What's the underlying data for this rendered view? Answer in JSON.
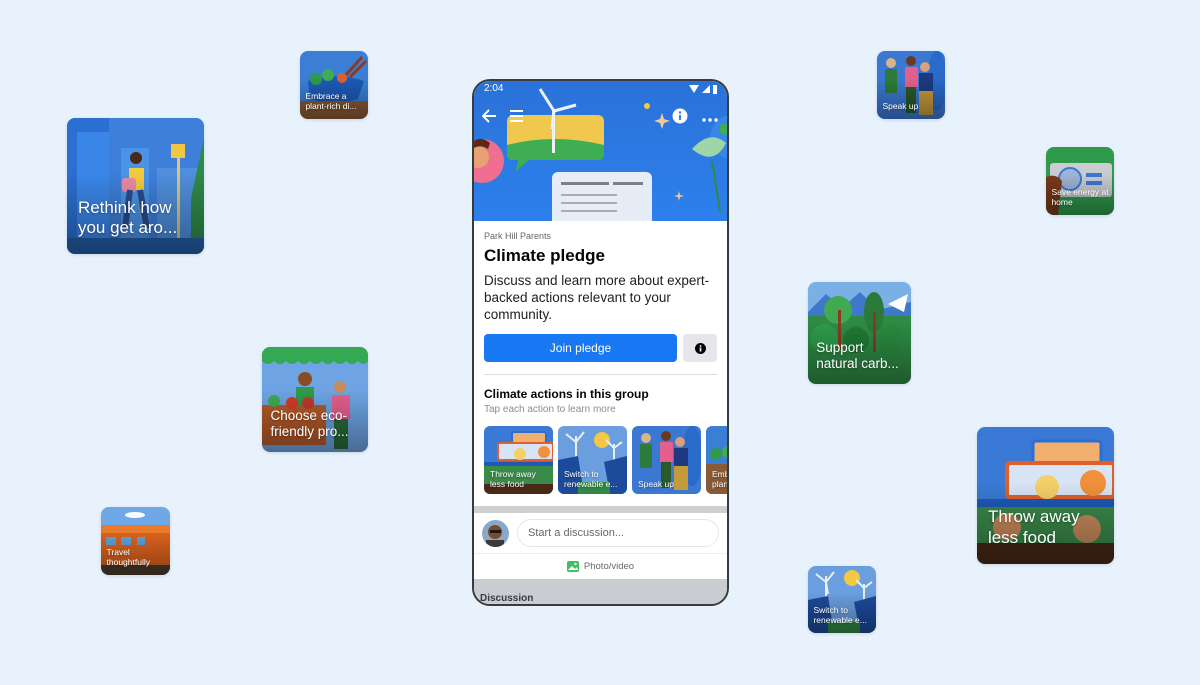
{
  "colors": {
    "background": "#E7F2FD",
    "brand_blue": "#1877F2",
    "hero_blue": "#2D80EC"
  },
  "floating_tiles": [
    {
      "id": "rethink-travel",
      "label": "Rethink how you get aro...",
      "theme": "city"
    },
    {
      "id": "plant-rich-diet",
      "label": "Embrace a plant-rich di...",
      "theme": "food"
    },
    {
      "id": "eco-friendly-products",
      "label": "Choose eco-friendly pro...",
      "theme": "market"
    },
    {
      "id": "travel-thoughtfully",
      "label": "Travel thoughtfully",
      "theme": "train"
    },
    {
      "id": "speak-up",
      "label": "Speak up",
      "theme": "people"
    },
    {
      "id": "save-energy",
      "label": "Save energy at home",
      "theme": "thermostat"
    },
    {
      "id": "natural-carbon",
      "label": "Support natural carb...",
      "theme": "forest"
    },
    {
      "id": "less-food-waste",
      "label": "Throw away less food",
      "theme": "leftovers"
    },
    {
      "id": "renewable-energy",
      "label": "Switch to renewable e...",
      "theme": "wind-solar"
    }
  ],
  "phone": {
    "status_bar": {
      "time": "2:04",
      "icons": [
        "wifi-icon",
        "signal-icon",
        "battery-icon"
      ]
    },
    "nav": {
      "back": "back-arrow-icon",
      "menu": "menu-icon",
      "info": "info-icon",
      "more": "more-icon"
    },
    "group_name": "Park Hill Parents",
    "title": "Climate pledge",
    "description": "Discuss and learn more about expert-backed actions relevant to your community.",
    "join_button": "Join pledge",
    "actions_section": {
      "title": "Climate actions in this group",
      "subtitle": "Tap each action to learn more",
      "items": [
        {
          "label": "Throw away less food",
          "theme": "leftovers"
        },
        {
          "label": "Switch to renewable e...",
          "theme": "wind-solar"
        },
        {
          "label": "Speak up",
          "theme": "people"
        },
        {
          "label": "Embrace a plant...",
          "theme": "food"
        }
      ]
    },
    "composer": {
      "placeholder": "Start a discussion...",
      "photo_video": "Photo/video"
    },
    "discussion_label": "Discussion"
  }
}
